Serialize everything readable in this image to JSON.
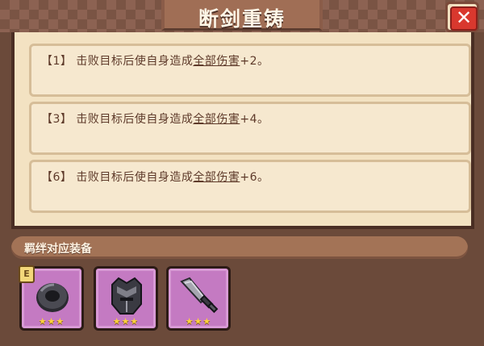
{
  "window": {
    "title": "断剑重铸",
    "close_icon": "close-icon"
  },
  "effects": [
    {
      "prefix": "【1】 击败目标后使自身造成",
      "keyword": "全部伤害",
      "suffix": "+2。"
    },
    {
      "prefix": "【3】 击败目标后使自身造成",
      "keyword": "全部伤害",
      "suffix": "+4。"
    },
    {
      "prefix": "【6】 击败目标后使自身造成",
      "keyword": "全部伤害",
      "suffix": "+6。"
    }
  ],
  "bond": {
    "label": "羁绊对应装备",
    "items": [
      {
        "icon": "ring-icon",
        "stars": "★★★",
        "star_count": 3,
        "badge": "E"
      },
      {
        "icon": "helmet-icon",
        "stars": "★★★",
        "star_count": 3
      },
      {
        "icon": "broken-sword-icon",
        "stars": "★★★",
        "star_count": 3
      }
    ]
  },
  "colors": {
    "accent_purple": "#c47ac2",
    "close_red": "#d9382e",
    "panel_cream": "#f3e2c2"
  }
}
